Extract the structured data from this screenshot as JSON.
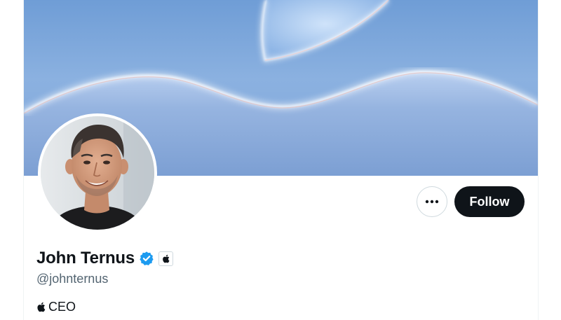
{
  "profile": {
    "display_name": "John Ternus",
    "handle": "@johnternus",
    "bio_text": "CEO",
    "verified": true,
    "affiliation_icon": "apple-logo-icon",
    "bio_icon": "apple-logo-icon"
  },
  "actions": {
    "more_icon": "more-horizontal-icon",
    "follow_label": "Follow"
  },
  "colors": {
    "follow_button_bg": "#0f1419",
    "verified_blue": "#1d9bf0",
    "handle_gray": "#536471"
  }
}
